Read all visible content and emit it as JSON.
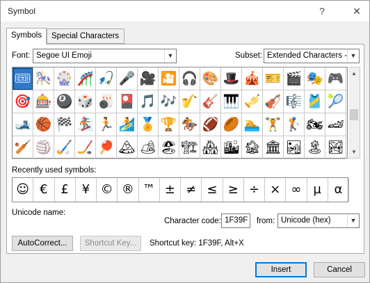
{
  "window": {
    "title": "Symbol",
    "help_label": "?",
    "close_label": "✕"
  },
  "tabs": [
    {
      "label": "Symbols",
      "active": true
    },
    {
      "label": "Special Characters",
      "active": false
    }
  ],
  "font": {
    "label": "Font:",
    "value": "Segoe UI Emoji"
  },
  "subset": {
    "label": "Subset:",
    "value": "Extended Characters -"
  },
  "symbol_grid": [
    [
      "🎟",
      "🎠",
      "🎡",
      "🎢",
      "🎣",
      "🎤",
      "🎥",
      "🎦",
      "🎧",
      "🎨",
      "🎩",
      "🎪",
      "🎫",
      "🎬",
      "🎭",
      "🎮"
    ],
    [
      "🎯",
      "🎰",
      "🎱",
      "🎲",
      "🎳",
      "🎴",
      "🎵",
      "🎶",
      "🎷",
      "🎸",
      "🎹",
      "🎺",
      "🎻",
      "🎼",
      "🎽",
      "🎾"
    ],
    [
      "🎿",
      "🏀",
      "🏁",
      "🏂",
      "🏃",
      "🏄",
      "🏅",
      "🏆",
      "🏇",
      "🏈",
      "🏉",
      "🏊",
      "🏋",
      "🏌",
      "🏍",
      "🏎"
    ],
    [
      "🏏",
      "🏐",
      "🏑",
      "🏒",
      "🏓",
      "🏔",
      "🏕",
      "🏖",
      "🏗",
      "🏘",
      "🏙",
      "🏚",
      "🏛",
      "🏜",
      "🏝",
      "🏞"
    ]
  ],
  "recent": {
    "label": "Recently used symbols:",
    "symbols": [
      "☺",
      "€",
      "£",
      "¥",
      "©",
      "®",
      "™",
      "±",
      "≠",
      "≤",
      "≥",
      "÷",
      "×",
      "∞",
      "µ",
      "α"
    ]
  },
  "unicode_name": {
    "label": "Unicode name:"
  },
  "character_code": {
    "label": "Character code:",
    "value": "1F39F"
  },
  "from": {
    "label": "from:",
    "value": "Unicode (hex)"
  },
  "buttons": {
    "autocorrect": "AutoCorrect...",
    "shortcut_key": "Shortcut Key...",
    "insert": "Insert",
    "cancel": "Cancel"
  },
  "shortcut_text": "Shortcut key: 1F39F, Alt+X",
  "colors": {
    "selection": "#2f7ac8",
    "default_button_border": "#0078d7"
  }
}
